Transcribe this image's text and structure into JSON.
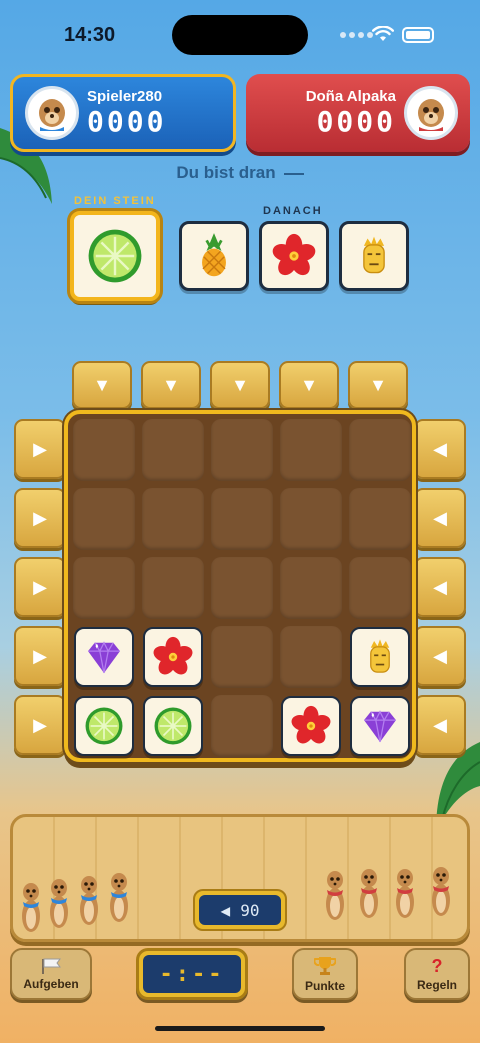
{
  "status": {
    "time": "14:30"
  },
  "player": {
    "name": "Spieler280",
    "score": "0000"
  },
  "opponent": {
    "name": "Doña Alpaka",
    "score": "0000"
  },
  "turn_text": "Du bist dran",
  "current_label": "DEIN STEIN",
  "next_label": "DANACH",
  "current_piece": "lime",
  "next_pieces": [
    "pineapple",
    "hibiscus",
    "mask"
  ],
  "board": [
    [
      null,
      null,
      null,
      null,
      null
    ],
    [
      null,
      null,
      null,
      null,
      null
    ],
    [
      null,
      null,
      null,
      null,
      null
    ],
    [
      "gem",
      "hibiscus",
      null,
      null,
      "mask"
    ],
    [
      "lime",
      "lime",
      null,
      "hibiscus",
      "gem"
    ]
  ],
  "counter": {
    "arrow": "◀",
    "value": "90"
  },
  "timer": "-:--",
  "buttons": {
    "give_up": "Aufgeben",
    "points": "Punkte",
    "rules": "Regeln"
  },
  "icons": {
    "give_up": "flag-icon",
    "points": "trophy-icon",
    "rules": "question-icon"
  },
  "colors": {
    "player": "#2277cc",
    "opponent": "#cc3a3f",
    "accent": "#f1b622",
    "board": "#6b4421"
  }
}
